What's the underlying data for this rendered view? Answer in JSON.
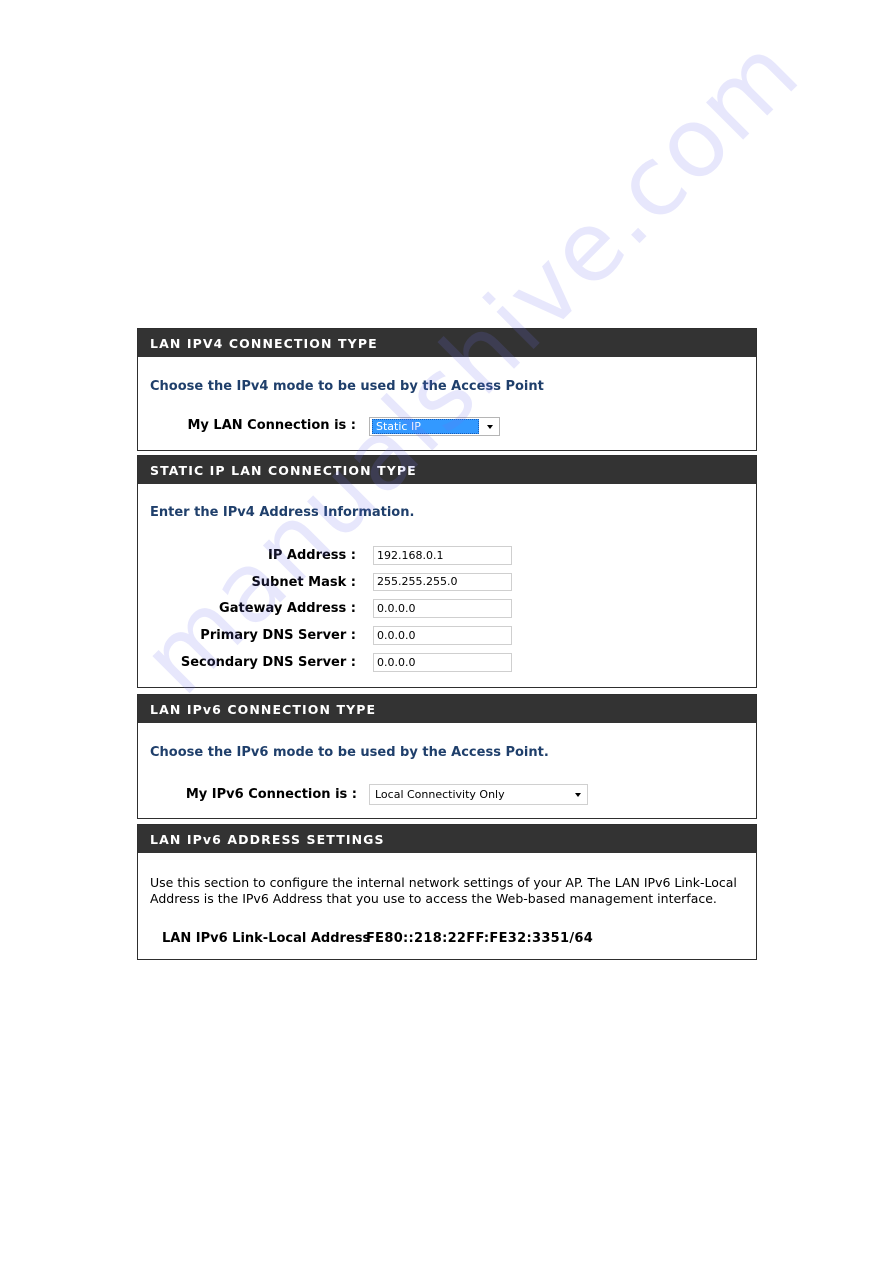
{
  "ipv4_connection": {
    "header": "LAN IPV4 CONNECTION TYPE",
    "subtitle": "Choose the IPv4 mode to be used by the Access Point",
    "label": "My LAN Connection is :",
    "selected": "Static IP"
  },
  "static_ip": {
    "header": "STATIC IP LAN CONNECTION TYPE",
    "subtitle": "Enter the IPv4 Address Information.",
    "fields": [
      {
        "label": "IP Address :",
        "value": "192.168.0.1"
      },
      {
        "label": "Subnet Mask :",
        "value": "255.255.255.0"
      },
      {
        "label": "Gateway Address :",
        "value": "0.0.0.0"
      },
      {
        "label": "Primary DNS Server :",
        "value": "0.0.0.0"
      },
      {
        "label": "Secondary DNS Server :",
        "value": "0.0.0.0"
      }
    ]
  },
  "ipv6_connection": {
    "header": "LAN IPv6 CONNECTION TYPE",
    "subtitle": "Choose the IPv6 mode to be used by the Access Point.",
    "label": "My IPv6 Connection is :",
    "selected": "Local Connectivity Only"
  },
  "ipv6_address": {
    "header": "LAN IPv6 ADDRESS SETTINGS",
    "description": "Use this section to configure the internal network settings of your AP. The LAN IPv6 Link-Local Address is the IPv6 Address that you use to access the Web-based management interface.",
    "label": "LAN IPv6 Link-Local Address :",
    "value": "FE80::218:22FF:FE32:3351/64"
  },
  "watermark": "manualshive.com"
}
